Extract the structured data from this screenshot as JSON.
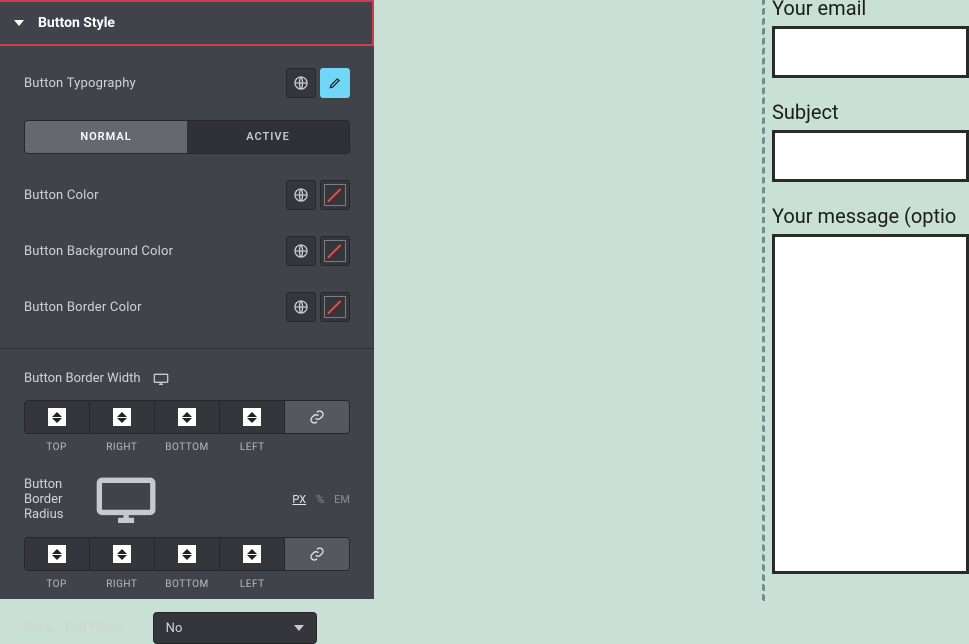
{
  "section": {
    "title": "Button Style"
  },
  "typography": {
    "label": "Button Typography"
  },
  "tabs": {
    "normal": "NORMAL",
    "active": "ACTIVE"
  },
  "colors": {
    "button_color": "Button Color",
    "background_color": "Button Background Color",
    "border_color": "Button Border Color"
  },
  "border_width": {
    "label": "Button Border Width",
    "sides": {
      "top": "TOP",
      "right": "RIGHT",
      "bottom": "BOTTOM",
      "left": "LEFT"
    }
  },
  "border_radius": {
    "label": "Button Border Radius",
    "units": {
      "px": "PX",
      "pct": "%",
      "em": "EM"
    },
    "sides": {
      "top": "TOP",
      "right": "RIGHT",
      "bottom": "BOTTOM",
      "left": "LEFT"
    }
  },
  "full_width": {
    "label": "Button Full Width",
    "value": "No"
  },
  "preview_form": {
    "email_label": "Your email",
    "subject_label": "Subject",
    "message_label": "Your message (optio"
  }
}
